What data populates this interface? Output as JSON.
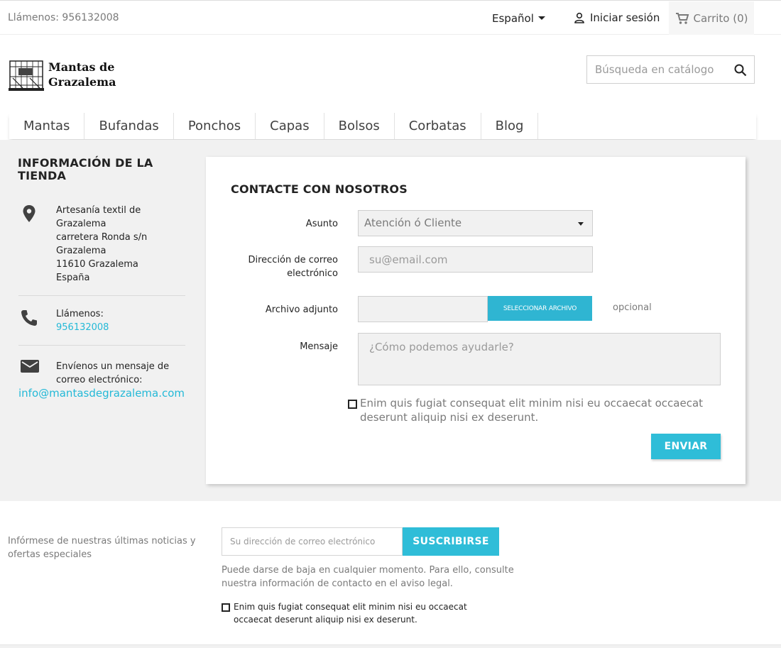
{
  "topbar": {
    "phone": "Llámenos: 956132008",
    "language": "Español",
    "login": "Iniciar sesión",
    "cart": "Carrito (0)"
  },
  "header": {
    "logo_line1": "Mantas de",
    "logo_line2": "Grazalema",
    "search_placeholder": "Búsqueda en catálogo"
  },
  "nav": {
    "items": [
      "Mantas",
      "Bufandas",
      "Ponchos",
      "Capas",
      "Bolsos",
      "Corbatas",
      "Blog"
    ]
  },
  "store": {
    "title": "INFORMACIÓN DE LA TIENDA",
    "address_lines": [
      "Artesanía textil de",
      "Grazalema",
      "carretera Ronda s/n",
      "Grazalema",
      "11610 Grazalema",
      "España"
    ],
    "call_label": "Llámenos:",
    "call_number": "956132008",
    "mail_label": "Envíenos un mensaje de correo electrónico:",
    "mail_address": "info@mantasdegrazalema.com"
  },
  "contact": {
    "title": "CONTACTE CON NOSOTROS",
    "subject_label": "Asunto",
    "subject_value": "Atención ó Cliente",
    "email_label": "Dirección de correo electrónico",
    "email_placeholder": "su@email.com",
    "attachment_label": "Archivo adjunto",
    "attachment_button": "SELECCIONAR ARCHIVO",
    "optional": "opcional",
    "message_label": "Mensaje",
    "message_placeholder": "¿Cómo podemos ayudarle?",
    "consent": "Enim quis fugiat consequat elit minim nisi eu occaecat occaecat deserunt aliquip nisi ex deserunt.",
    "send": "ENVIAR"
  },
  "newsletter": {
    "label": "Infórmese de nuestras últimas noticias y ofertas especiales",
    "input_placeholder": "Su dirección de correo electrónico",
    "button": "SUSCRIBIRSE",
    "note": "Puede darse de baja en cualquier momento. Para ello, consulte nuestra información de contacto en el aviso legal.",
    "consent": "Enim quis fugiat consequat elit minim nisi eu occaecat occaecat deserunt aliquip nisi ex deserunt."
  },
  "colors": {
    "accent": "#2fb5d2",
    "background": "#f1f1f1",
    "text": "#232323",
    "muted": "#7a7a7a"
  },
  "icons": [
    "person-icon",
    "cart-icon",
    "search-icon",
    "location-pin-icon",
    "phone-icon",
    "envelope-icon",
    "caret-down-icon",
    "logo-loom-icon"
  ]
}
